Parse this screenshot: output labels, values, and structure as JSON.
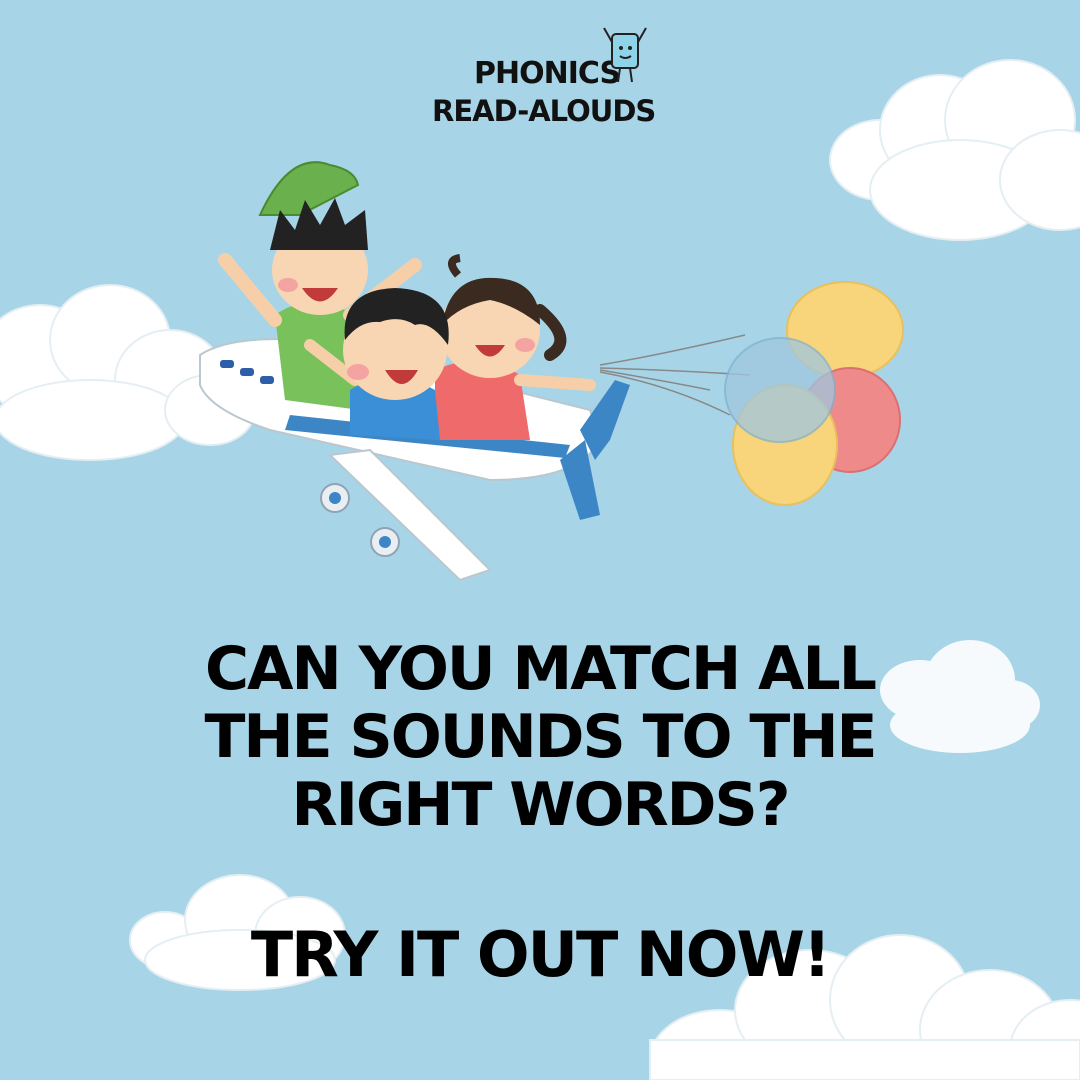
{
  "colors": {
    "sky": "#a7d5e7",
    "cloud": "#ffffff",
    "text": "#000000"
  },
  "logo": {
    "line1": "PHONICS",
    "line2": "READ-ALOUDS",
    "mascot_icon": "book-mascot-icon"
  },
  "illustration": {
    "icons": [
      "airplane-icon",
      "children-icon",
      "balloons-icon",
      "cloud-icon"
    ]
  },
  "headline": {
    "line1": "CAN YOU MATCH ALL",
    "line2": "THE SOUNDS TO THE",
    "line3": "RIGHT WORDS?"
  },
  "cta": "TRY IT OUT NOW!"
}
